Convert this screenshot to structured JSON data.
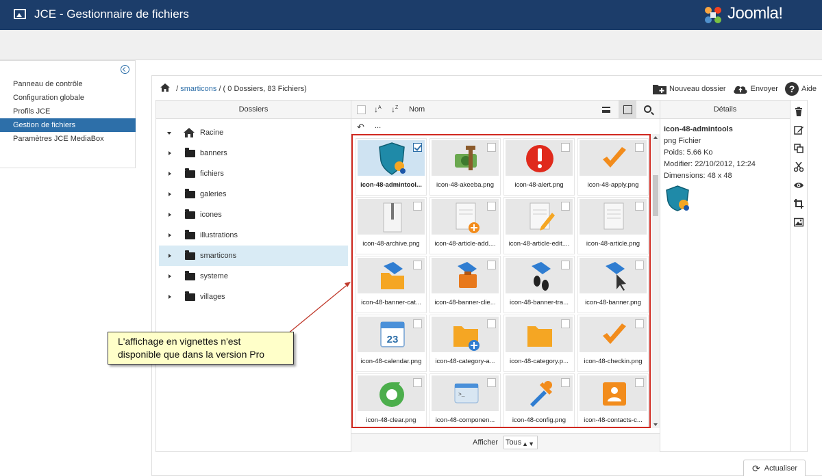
{
  "app": {
    "title": "JCE - Gestionnaire de fichiers",
    "logo_text": "Joomla!"
  },
  "sidebar": {
    "items": [
      {
        "label": "Panneau de contrôle"
      },
      {
        "label": "Configuration globale"
      },
      {
        "label": "Profils JCE"
      },
      {
        "label": "Gestion de fichiers",
        "active": true
      },
      {
        "label": "Paramètres JCE MediaBox"
      }
    ]
  },
  "breadcrumb": {
    "folder": "smarticons",
    "summary": "/ ( 0 Dossiers, 83 Fichiers)"
  },
  "actions": {
    "new_folder": "Nouveau dossier",
    "upload": "Envoyer",
    "help": "Aide"
  },
  "folders_panel": {
    "header": "Dossiers",
    "items": [
      {
        "label": "Racine"
      },
      {
        "label": "banners"
      },
      {
        "label": "fichiers"
      },
      {
        "label": "galeries"
      },
      {
        "label": "icones"
      },
      {
        "label": "illustrations"
      },
      {
        "label": "smarticons",
        "selected": true
      },
      {
        "label": "systeme"
      },
      {
        "label": "villages"
      }
    ]
  },
  "files_panel": {
    "column_label": "Nom",
    "parent_label": "...",
    "files": [
      {
        "name": "icon-48-admintool...",
        "selected": true,
        "icon": "admintools-shield-icon"
      },
      {
        "name": "icon-48-akeeba.png",
        "icon": "akeeba-icon"
      },
      {
        "name": "icon-48-alert.png",
        "icon": "alert-icon"
      },
      {
        "name": "icon-48-apply.png",
        "icon": "checkmark-icon"
      },
      {
        "name": "icon-48-archive.png",
        "icon": "archive-icon"
      },
      {
        "name": "icon-48-article-add....",
        "icon": "article-add-icon"
      },
      {
        "name": "icon-48-article-edit....",
        "icon": "article-edit-icon"
      },
      {
        "name": "icon-48-article.png",
        "icon": "article-icon"
      },
      {
        "name": "icon-48-banner-cat...",
        "icon": "banner-category-icon"
      },
      {
        "name": "icon-48-banner-clie...",
        "icon": "banner-client-icon"
      },
      {
        "name": "icon-48-banner-tra...",
        "icon": "banner-tracks-icon"
      },
      {
        "name": "icon-48-banner.png",
        "icon": "banner-icon"
      },
      {
        "name": "icon-48-calendar.png",
        "icon": "calendar-icon"
      },
      {
        "name": "icon-48-category-a...",
        "icon": "category-add-icon"
      },
      {
        "name": "icon-48-category.p...",
        "icon": "category-icon"
      },
      {
        "name": "icon-48-checkin.png",
        "icon": "checkmark-icon"
      },
      {
        "name": "icon-48-clear.png",
        "icon": "clear-icon"
      },
      {
        "name": "icon-48-componen...",
        "icon": "component-icon"
      },
      {
        "name": "icon-48-config.png",
        "icon": "config-icon"
      },
      {
        "name": "icon-48-contacts-c...",
        "icon": "contacts-icon"
      }
    ],
    "calendar_number": "23",
    "show_label": "Afficher",
    "show_value": "Tous"
  },
  "details_panel": {
    "header": "Détails",
    "name": "icon-48-admintools",
    "type": "png Fichier",
    "size": "Poids: 5.66 Ko",
    "modified": "Modifier: 22/10/2012, 12:24",
    "dimensions": "Dimensions: 48 x 48"
  },
  "refresh_label": "Actualiser",
  "callout": {
    "line1": "L'affichage en vignettes n'est",
    "line2": "disponible que dans la version Pro"
  },
  "colors": {
    "topbar": "#1c3d6a",
    "accent": "#2d6fa9",
    "highlight_border": "#d0281f",
    "callout_bg": "#ffffc9"
  }
}
